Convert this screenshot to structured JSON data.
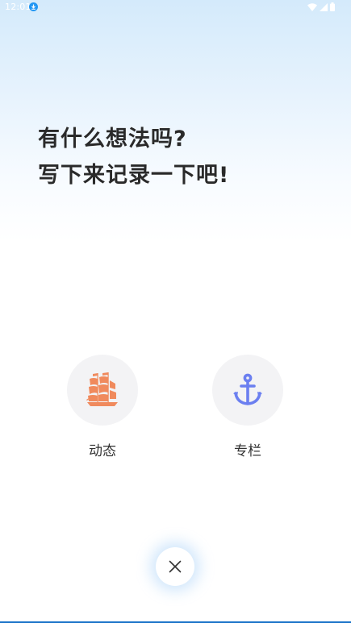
{
  "status_bar": {
    "time": "12:01",
    "icons": [
      "download-icon",
      "wifi-icon",
      "signal-icon",
      "battery-icon"
    ]
  },
  "headline": {
    "line1": "有什么想法吗?",
    "line2": "写下来记录一下吧!"
  },
  "options": {
    "dynamic": {
      "label": "动态",
      "icon": "sailing-ship-icon",
      "icon_color": "#f08a5d"
    },
    "column": {
      "label": "专栏",
      "icon": "anchor-icon",
      "icon_color": "#6b7ff0"
    }
  },
  "close": {
    "icon": "close-icon"
  },
  "colors": {
    "headline": "#2a2a2a",
    "circle_bg": "#f3f3f5",
    "gradient_top": "#d4eafb",
    "accent_line": "#1a73c8"
  }
}
